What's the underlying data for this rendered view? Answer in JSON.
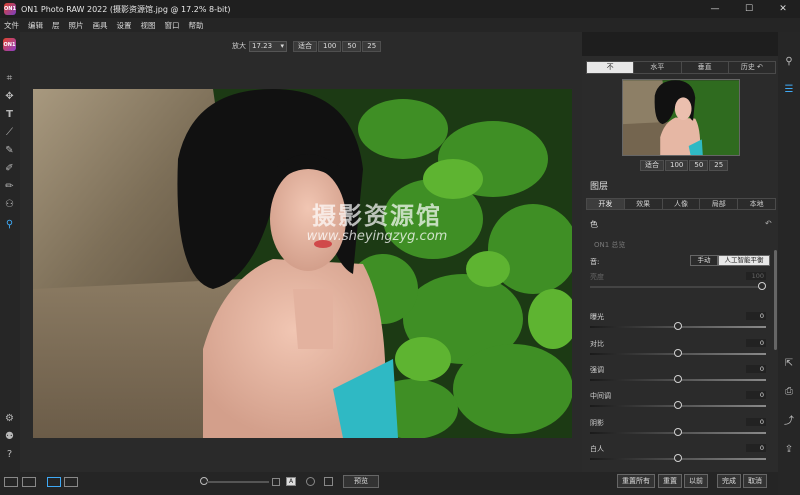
{
  "window": {
    "title": "ON1 Photo RAW 2022 (摄影资源馆.jpg @ 17.2% 8-bit)",
    "minimize": "—",
    "maximize": "☐",
    "close": "✕"
  },
  "menu": [
    "文件",
    "编辑",
    "层",
    "照片",
    "画具",
    "设置",
    "视图",
    "窗口",
    "帮助"
  ],
  "zoom": {
    "label": "放大",
    "value": "17.23",
    "buttons": [
      "适合",
      "100",
      "50",
      "25"
    ]
  },
  "watermark": {
    "main": "摄影资源馆",
    "url": "www.sheyingzyg.com"
  },
  "view_tabs": [
    "不",
    "水平",
    "垂直",
    "历史 ↶"
  ],
  "nav_zoom": [
    "适合",
    "100",
    "50",
    "25"
  ],
  "layers": {
    "title": "图层",
    "tabs": [
      "开发",
      "效果",
      "人像",
      "局部",
      "本地"
    ]
  },
  "develop": {
    "header": "色",
    "subheader": "ON1 总览",
    "tone_label": "音:",
    "tone_modes": [
      "手动",
      "人工智能平衡"
    ],
    "sliders": [
      {
        "name": "亮度",
        "value": "100",
        "dim": true,
        "pos": 1.0
      },
      {
        "name": "曝光",
        "value": "0",
        "dim": false,
        "pos": 0.5
      },
      {
        "name": "对比",
        "value": "0",
        "dim": false,
        "pos": 0.5
      },
      {
        "name": "强调",
        "value": "0",
        "dim": false,
        "pos": 0.5
      },
      {
        "name": "中间调",
        "value": "0",
        "dim": false,
        "pos": 0.5
      },
      {
        "name": "阴影",
        "value": "0",
        "dim": false,
        "pos": 0.5
      },
      {
        "name": "白人",
        "value": "0",
        "dim": false,
        "pos": 0.5
      }
    ]
  },
  "bottom": {
    "preview": "预览",
    "buttons": [
      "重置所有",
      "重置",
      "以前",
      "完成",
      "取消"
    ]
  }
}
